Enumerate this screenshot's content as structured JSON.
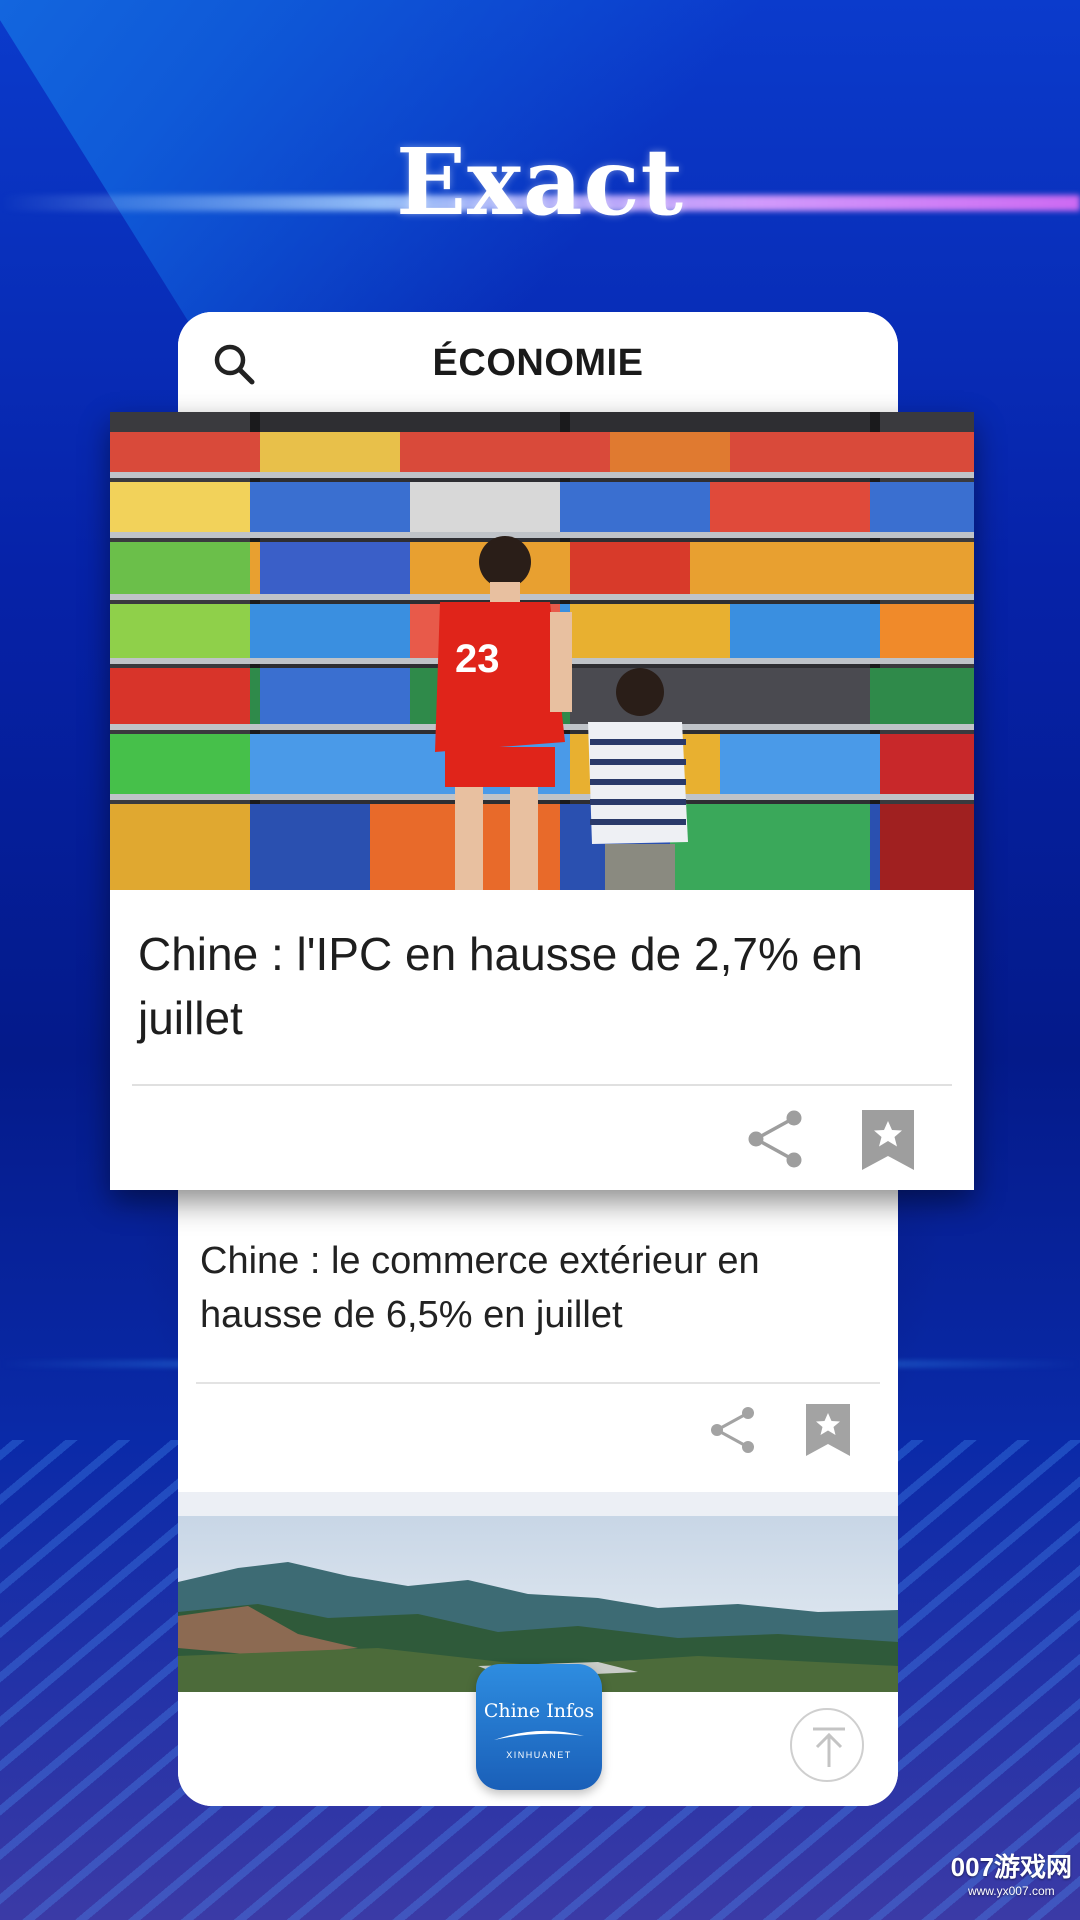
{
  "promo": {
    "headline": "Exact"
  },
  "app_header": {
    "section_title": "ÉCONOMIE",
    "search_icon": "search-icon"
  },
  "articles": [
    {
      "title": "Chine : l'IPC en hausse de 2,7% en juillet",
      "image": "supermarket-shelves-children",
      "actions": [
        "share-icon",
        "bookmark-icon"
      ]
    },
    {
      "title": "Chine : le commerce extérieur en hausse de 6,5% en juillet",
      "actions": [
        "share-icon",
        "bookmark-icon"
      ]
    },
    {
      "image": "mountain-landscape"
    }
  ],
  "app_logo": {
    "name": "Chine Infos",
    "subtitle": "XINHUANET"
  },
  "scroll_top_icon": "arrow-up-to-top-icon",
  "watermark": {
    "main": "007游戏网",
    "sub": "www.yx007.com"
  },
  "colors": {
    "background": "#0a2aa8",
    "card": "#ffffff",
    "logo_blue": "#2e8de0",
    "icon_gray": "#9e9e9e"
  }
}
